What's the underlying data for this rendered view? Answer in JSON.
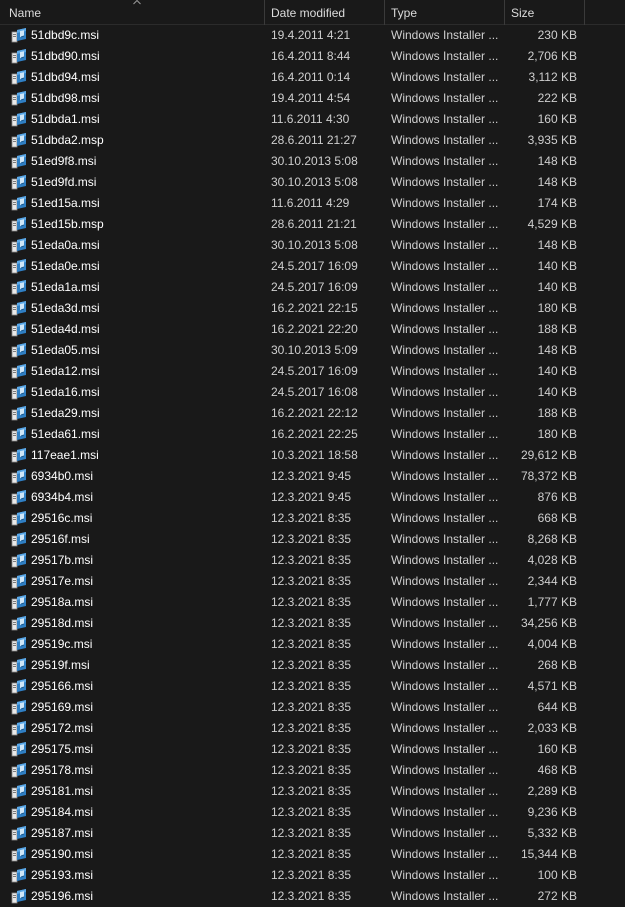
{
  "columns": {
    "name": "Name",
    "date": "Date modified",
    "type": "Type",
    "size": "Size"
  },
  "sort": {
    "column": "name",
    "icon": "sort-ascending-icon"
  },
  "file_icon": "msi-installer-icon",
  "files": [
    {
      "name": "51dbd9c.msi",
      "date": "19.4.2011 4:21",
      "type": "Windows Installer ...",
      "size": "230 KB"
    },
    {
      "name": "51dbd90.msi",
      "date": "16.4.2011 8:44",
      "type": "Windows Installer ...",
      "size": "2,706 KB"
    },
    {
      "name": "51dbd94.msi",
      "date": "16.4.2011 0:14",
      "type": "Windows Installer ...",
      "size": "3,112 KB"
    },
    {
      "name": "51dbd98.msi",
      "date": "19.4.2011 4:54",
      "type": "Windows Installer ...",
      "size": "222 KB"
    },
    {
      "name": "51dbda1.msi",
      "date": "11.6.2011 4:30",
      "type": "Windows Installer ...",
      "size": "160 KB"
    },
    {
      "name": "51dbda2.msp",
      "date": "28.6.2011 21:27",
      "type": "Windows Installer ...",
      "size": "3,935 KB"
    },
    {
      "name": "51ed9f8.msi",
      "date": "30.10.2013 5:08",
      "type": "Windows Installer ...",
      "size": "148 KB"
    },
    {
      "name": "51ed9fd.msi",
      "date": "30.10.2013 5:08",
      "type": "Windows Installer ...",
      "size": "148 KB"
    },
    {
      "name": "51ed15a.msi",
      "date": "11.6.2011 4:29",
      "type": "Windows Installer ...",
      "size": "174 KB"
    },
    {
      "name": "51ed15b.msp",
      "date": "28.6.2011 21:21",
      "type": "Windows Installer ...",
      "size": "4,529 KB"
    },
    {
      "name": "51eda0a.msi",
      "date": "30.10.2013 5:08",
      "type": "Windows Installer ...",
      "size": "148 KB"
    },
    {
      "name": "51eda0e.msi",
      "date": "24.5.2017 16:09",
      "type": "Windows Installer ...",
      "size": "140 KB"
    },
    {
      "name": "51eda1a.msi",
      "date": "24.5.2017 16:09",
      "type": "Windows Installer ...",
      "size": "140 KB"
    },
    {
      "name": "51eda3d.msi",
      "date": "16.2.2021 22:15",
      "type": "Windows Installer ...",
      "size": "180 KB"
    },
    {
      "name": "51eda4d.msi",
      "date": "16.2.2021 22:20",
      "type": "Windows Installer ...",
      "size": "188 KB"
    },
    {
      "name": "51eda05.msi",
      "date": "30.10.2013 5:09",
      "type": "Windows Installer ...",
      "size": "148 KB"
    },
    {
      "name": "51eda12.msi",
      "date": "24.5.2017 16:09",
      "type": "Windows Installer ...",
      "size": "140 KB"
    },
    {
      "name": "51eda16.msi",
      "date": "24.5.2017 16:08",
      "type": "Windows Installer ...",
      "size": "140 KB"
    },
    {
      "name": "51eda29.msi",
      "date": "16.2.2021 22:12",
      "type": "Windows Installer ...",
      "size": "188 KB"
    },
    {
      "name": "51eda61.msi",
      "date": "16.2.2021 22:25",
      "type": "Windows Installer ...",
      "size": "180 KB"
    },
    {
      "name": "117eae1.msi",
      "date": "10.3.2021 18:58",
      "type": "Windows Installer ...",
      "size": "29,612 KB"
    },
    {
      "name": "6934b0.msi",
      "date": "12.3.2021 9:45",
      "type": "Windows Installer ...",
      "size": "78,372 KB"
    },
    {
      "name": "6934b4.msi",
      "date": "12.3.2021 9:45",
      "type": "Windows Installer ...",
      "size": "876 KB"
    },
    {
      "name": "29516c.msi",
      "date": "12.3.2021 8:35",
      "type": "Windows Installer ...",
      "size": "668 KB"
    },
    {
      "name": "29516f.msi",
      "date": "12.3.2021 8:35",
      "type": "Windows Installer ...",
      "size": "8,268 KB"
    },
    {
      "name": "29517b.msi",
      "date": "12.3.2021 8:35",
      "type": "Windows Installer ...",
      "size": "4,028 KB"
    },
    {
      "name": "29517e.msi",
      "date": "12.3.2021 8:35",
      "type": "Windows Installer ...",
      "size": "2,344 KB"
    },
    {
      "name": "29518a.msi",
      "date": "12.3.2021 8:35",
      "type": "Windows Installer ...",
      "size": "1,777 KB"
    },
    {
      "name": "29518d.msi",
      "date": "12.3.2021 8:35",
      "type": "Windows Installer ...",
      "size": "34,256 KB"
    },
    {
      "name": "29519c.msi",
      "date": "12.3.2021 8:35",
      "type": "Windows Installer ...",
      "size": "4,004 KB"
    },
    {
      "name": "29519f.msi",
      "date": "12.3.2021 8:35",
      "type": "Windows Installer ...",
      "size": "268 KB"
    },
    {
      "name": "295166.msi",
      "date": "12.3.2021 8:35",
      "type": "Windows Installer ...",
      "size": "4,571 KB"
    },
    {
      "name": "295169.msi",
      "date": "12.3.2021 8:35",
      "type": "Windows Installer ...",
      "size": "644 KB"
    },
    {
      "name": "295172.msi",
      "date": "12.3.2021 8:35",
      "type": "Windows Installer ...",
      "size": "2,033 KB"
    },
    {
      "name": "295175.msi",
      "date": "12.3.2021 8:35",
      "type": "Windows Installer ...",
      "size": "160 KB"
    },
    {
      "name": "295178.msi",
      "date": "12.3.2021 8:35",
      "type": "Windows Installer ...",
      "size": "468 KB"
    },
    {
      "name": "295181.msi",
      "date": "12.3.2021 8:35",
      "type": "Windows Installer ...",
      "size": "2,289 KB"
    },
    {
      "name": "295184.msi",
      "date": "12.3.2021 8:35",
      "type": "Windows Installer ...",
      "size": "9,236 KB"
    },
    {
      "name": "295187.msi",
      "date": "12.3.2021 8:35",
      "type": "Windows Installer ...",
      "size": "5,332 KB"
    },
    {
      "name": "295190.msi",
      "date": "12.3.2021 8:35",
      "type": "Windows Installer ...",
      "size": "15,344 KB"
    },
    {
      "name": "295193.msi",
      "date": "12.3.2021 8:35",
      "type": "Windows Installer ...",
      "size": "100 KB"
    },
    {
      "name": "295196.msi",
      "date": "12.3.2021 8:35",
      "type": "Windows Installer ...",
      "size": "272 KB"
    }
  ]
}
